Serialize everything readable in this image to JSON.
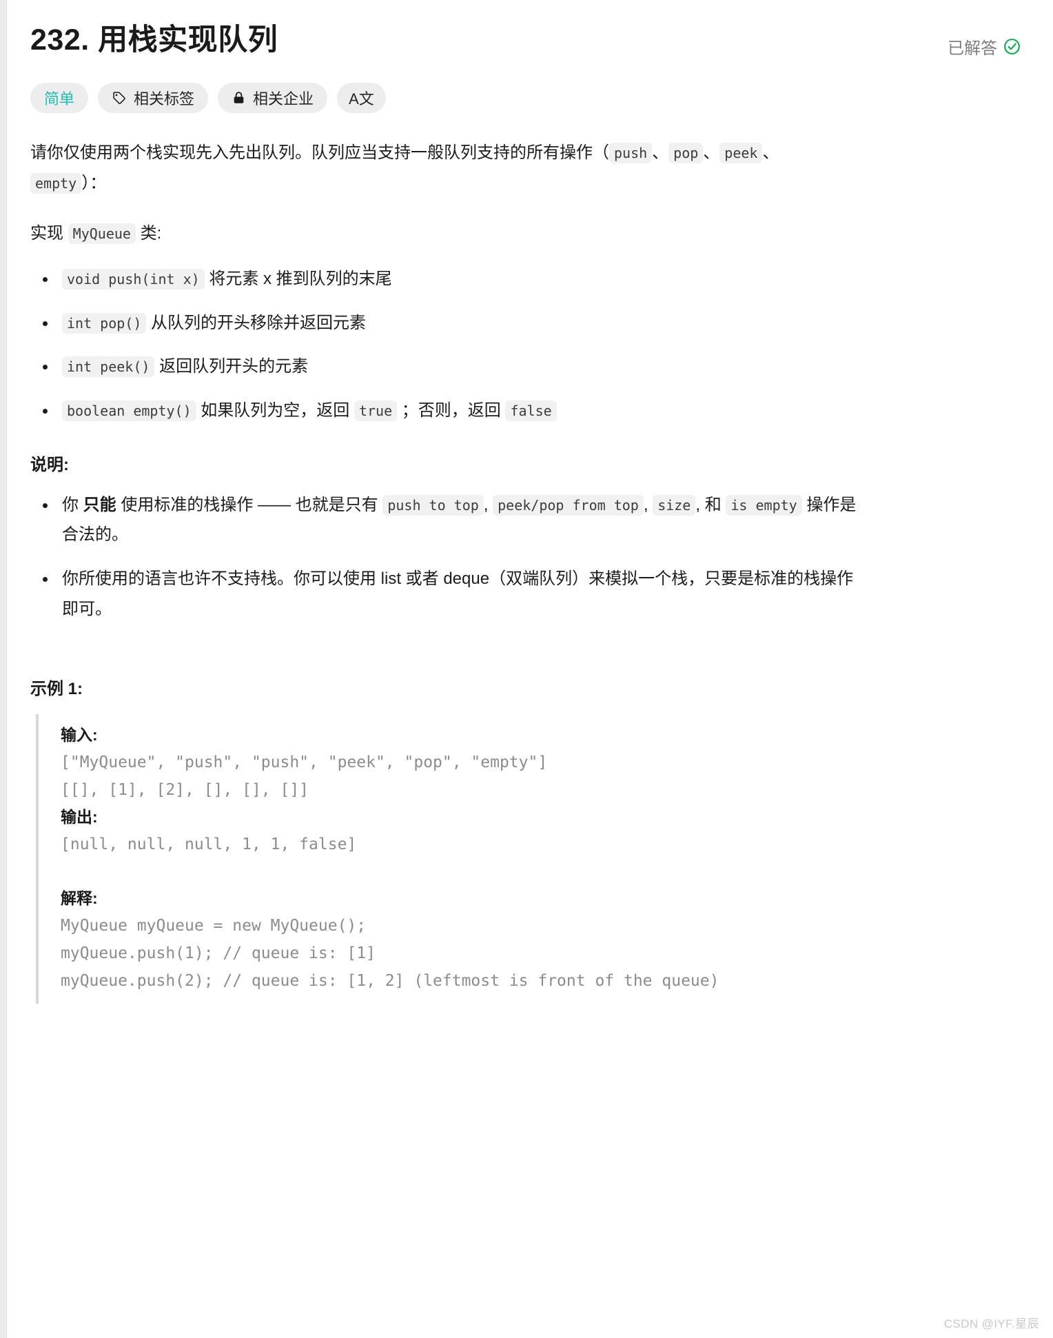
{
  "header": {
    "title": "232. 用栈实现队列",
    "status_label": "已解答",
    "status_icon": "check-circle-icon",
    "status_color": "#00af44"
  },
  "badges": [
    {
      "label": "简单",
      "icon": null,
      "kind": "difficulty"
    },
    {
      "label": "相关标签",
      "icon": "tag-icon",
      "kind": "normal"
    },
    {
      "label": "相关企业",
      "icon": "lock-icon",
      "kind": "normal"
    },
    {
      "label": "A文",
      "icon": "translate-icon",
      "kind": "icon-only"
    }
  ],
  "description": {
    "intro_p1": "请你仅使用两个栈实现先入先出队列。队列应当支持一般队列支持的所有操作（",
    "intro_code_push": "push",
    "intro_sep1": "、",
    "intro_code_pop": "pop",
    "intro_sep2": "、",
    "intro_code_peek": "peek",
    "intro_sep3": "、",
    "intro_code_empty": "empty",
    "intro_p2": "）：",
    "impl_prefix": "实现 ",
    "impl_code": "MyQueue",
    "impl_suffix": " 类:"
  },
  "methods": [
    {
      "code": "void push(int x)",
      "text": " 将元素 x 推到队列的末尾"
    },
    {
      "code": "int pop()",
      "text": " 从队列的开头移除并返回元素"
    },
    {
      "code": "int peek()",
      "text": " 返回队列开头的元素"
    }
  ],
  "method_empty": {
    "code": "boolean empty()",
    "text_a": " 如果队列为空，返回 ",
    "code_true": "true",
    "text_b": " ；否则，返回 ",
    "code_false": "false"
  },
  "notes": {
    "heading": "说明:",
    "note1": {
      "part_a": "你 ",
      "bold": "只能",
      "part_b": " 使用标准的栈操作 —— 也就是只有 ",
      "code_push_top": "push to top",
      "sep1": ", ",
      "code_peek_pop": "peek/pop from top",
      "sep2": ", ",
      "code_size": "size",
      "sep3": ", 和 ",
      "code_is_empty": "is empty",
      "part_c": " 操作是合法的。"
    },
    "note2": "你所使用的语言也许不支持栈。你可以使用 list 或者 deque（双端队列）来模拟一个栈，只要是标准的栈操作即可。"
  },
  "example": {
    "heading": "示例 1:",
    "input_label": "输入:",
    "input_lines": "[\"MyQueue\", \"push\", \"push\", \"peek\", \"pop\", \"empty\"]\n[[], [1], [2], [], [], []]",
    "output_label": "输出:",
    "output_lines": "[null, null, null, 1, 1, false]",
    "explain_label": "解释:",
    "explain_lines": "MyQueue myQueue = new MyQueue();\nmyQueue.push(1); // queue is: [1]\nmyQueue.push(2); // queue is: [1, 2] (leftmost is front of the queue)"
  },
  "watermark": "CSDN @IYF.星辰"
}
